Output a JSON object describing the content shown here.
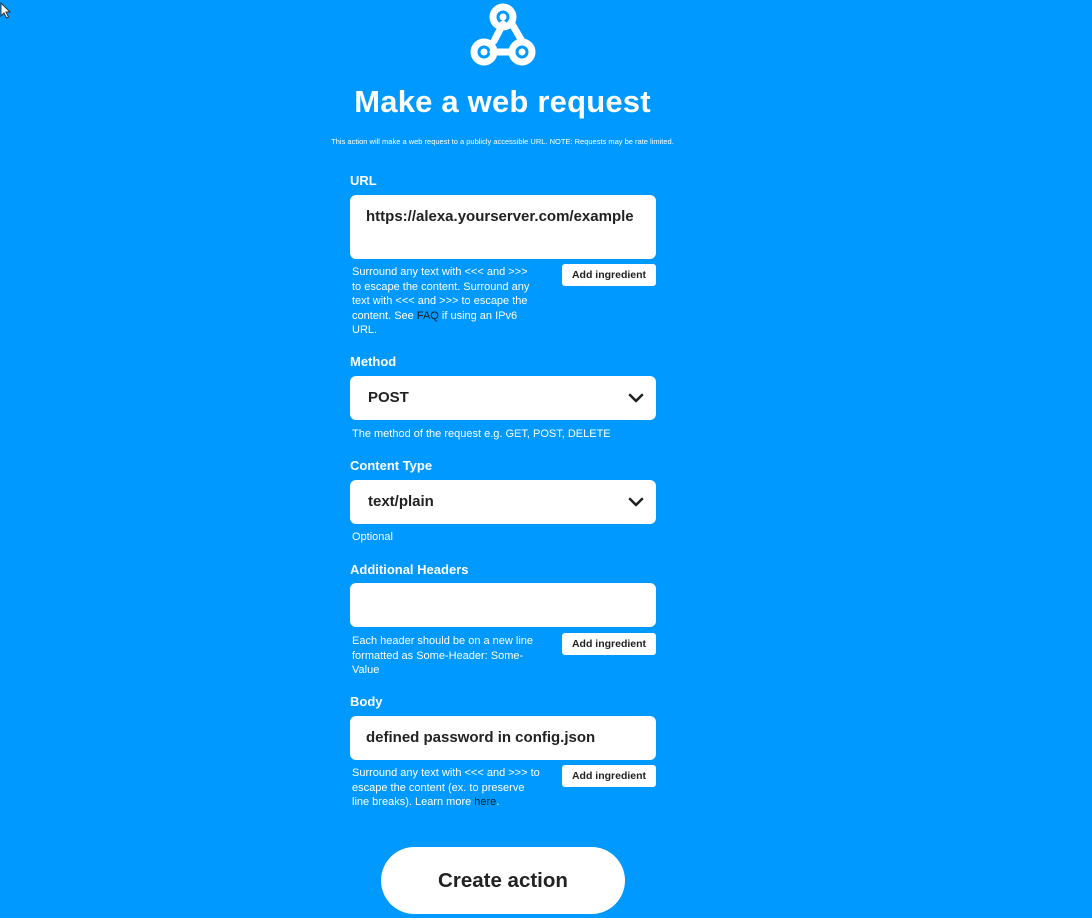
{
  "header": {
    "icon": "webhook-icon",
    "title": "Make a web request",
    "subtitle": "This action will make a web request to a publicly accessible URL. NOTE: Requests may be rate limited."
  },
  "url_section": {
    "label": "URL",
    "value": "https://alexa.yourserver.com/example",
    "help_text": "Surround any text with <<< and >>> to escape the content. Surround any text with <<< and >>> to escape the content. See ",
    "help_link": "FAQ",
    "help_suffix": " if using an IPv6 URL.",
    "ingredient_label": "Add ingredient"
  },
  "method_section": {
    "label": "Method",
    "value": "POST",
    "help_text": "The method of the request e.g. GET, POST, DELETE"
  },
  "content_type_section": {
    "label": "Content Type",
    "value": "text/plain",
    "help_text": "Optional"
  },
  "headers_section": {
    "label": "Additional Headers",
    "value": "",
    "help_text": "Each header should be on a new line formatted as Some-Header: Some-Value",
    "ingredient_label": "Add ingredient"
  },
  "body_section": {
    "label": "Body",
    "value": "defined password in config.json",
    "help_text": "Surround any text with <<< and >>> to escape the content (ex. to preserve line breaks). Learn more ",
    "help_link": "here",
    "help_suffix": ".",
    "ingredient_label": "Add ingredient"
  },
  "actions": {
    "create_label": "Create action"
  },
  "colors": {
    "background": "#0099ff",
    "field": "#ffffff",
    "text_dark": "#222222"
  }
}
